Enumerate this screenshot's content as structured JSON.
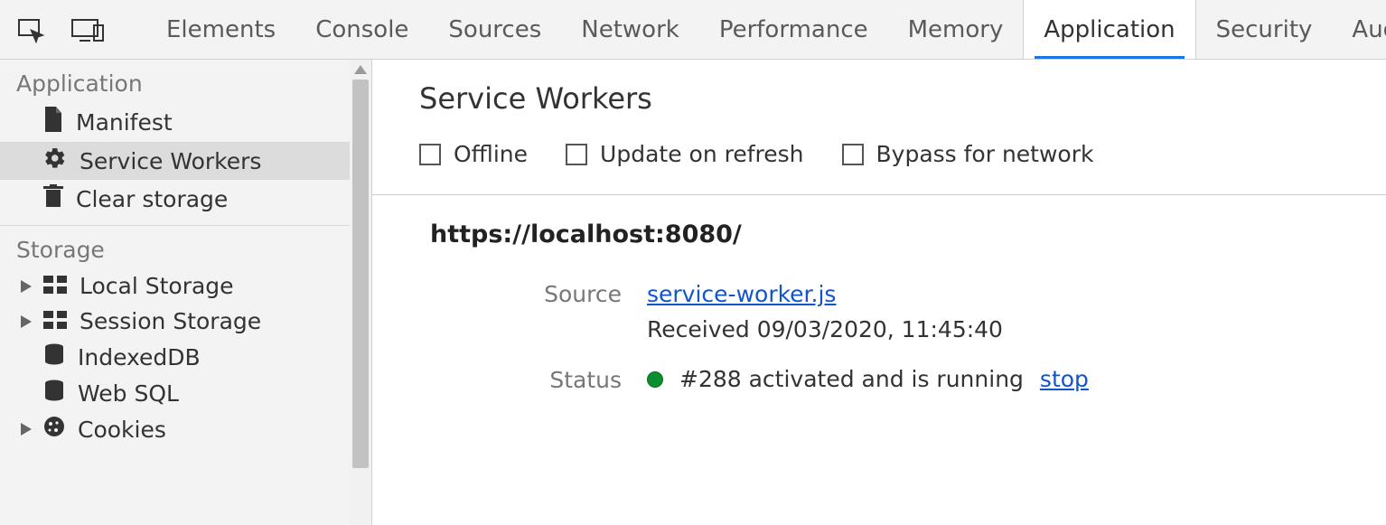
{
  "toolbar": {
    "tabs": [
      "Elements",
      "Console",
      "Sources",
      "Network",
      "Performance",
      "Memory",
      "Application",
      "Security",
      "Audits"
    ],
    "active": "Application"
  },
  "sidebar": {
    "application": {
      "title": "Application",
      "manifest": "Manifest",
      "service_workers": "Service Workers",
      "clear_storage": "Clear storage"
    },
    "storage": {
      "title": "Storage",
      "local_storage": "Local Storage",
      "session_storage": "Session Storage",
      "indexed_db": "IndexedDB",
      "web_sql": "Web SQL",
      "cookies": "Cookies"
    }
  },
  "main": {
    "title": "Service Workers",
    "options": {
      "offline": "Offline",
      "update_on_refresh": "Update on refresh",
      "bypass_for_network": "Bypass for network"
    },
    "origin": "https://localhost:8080/",
    "labels": {
      "source": "Source",
      "status": "Status"
    },
    "source_file": "service-worker.js",
    "received": "Received 09/03/2020, 11:45:40",
    "status_text": "#288 activated and is running",
    "stop": "stop"
  }
}
